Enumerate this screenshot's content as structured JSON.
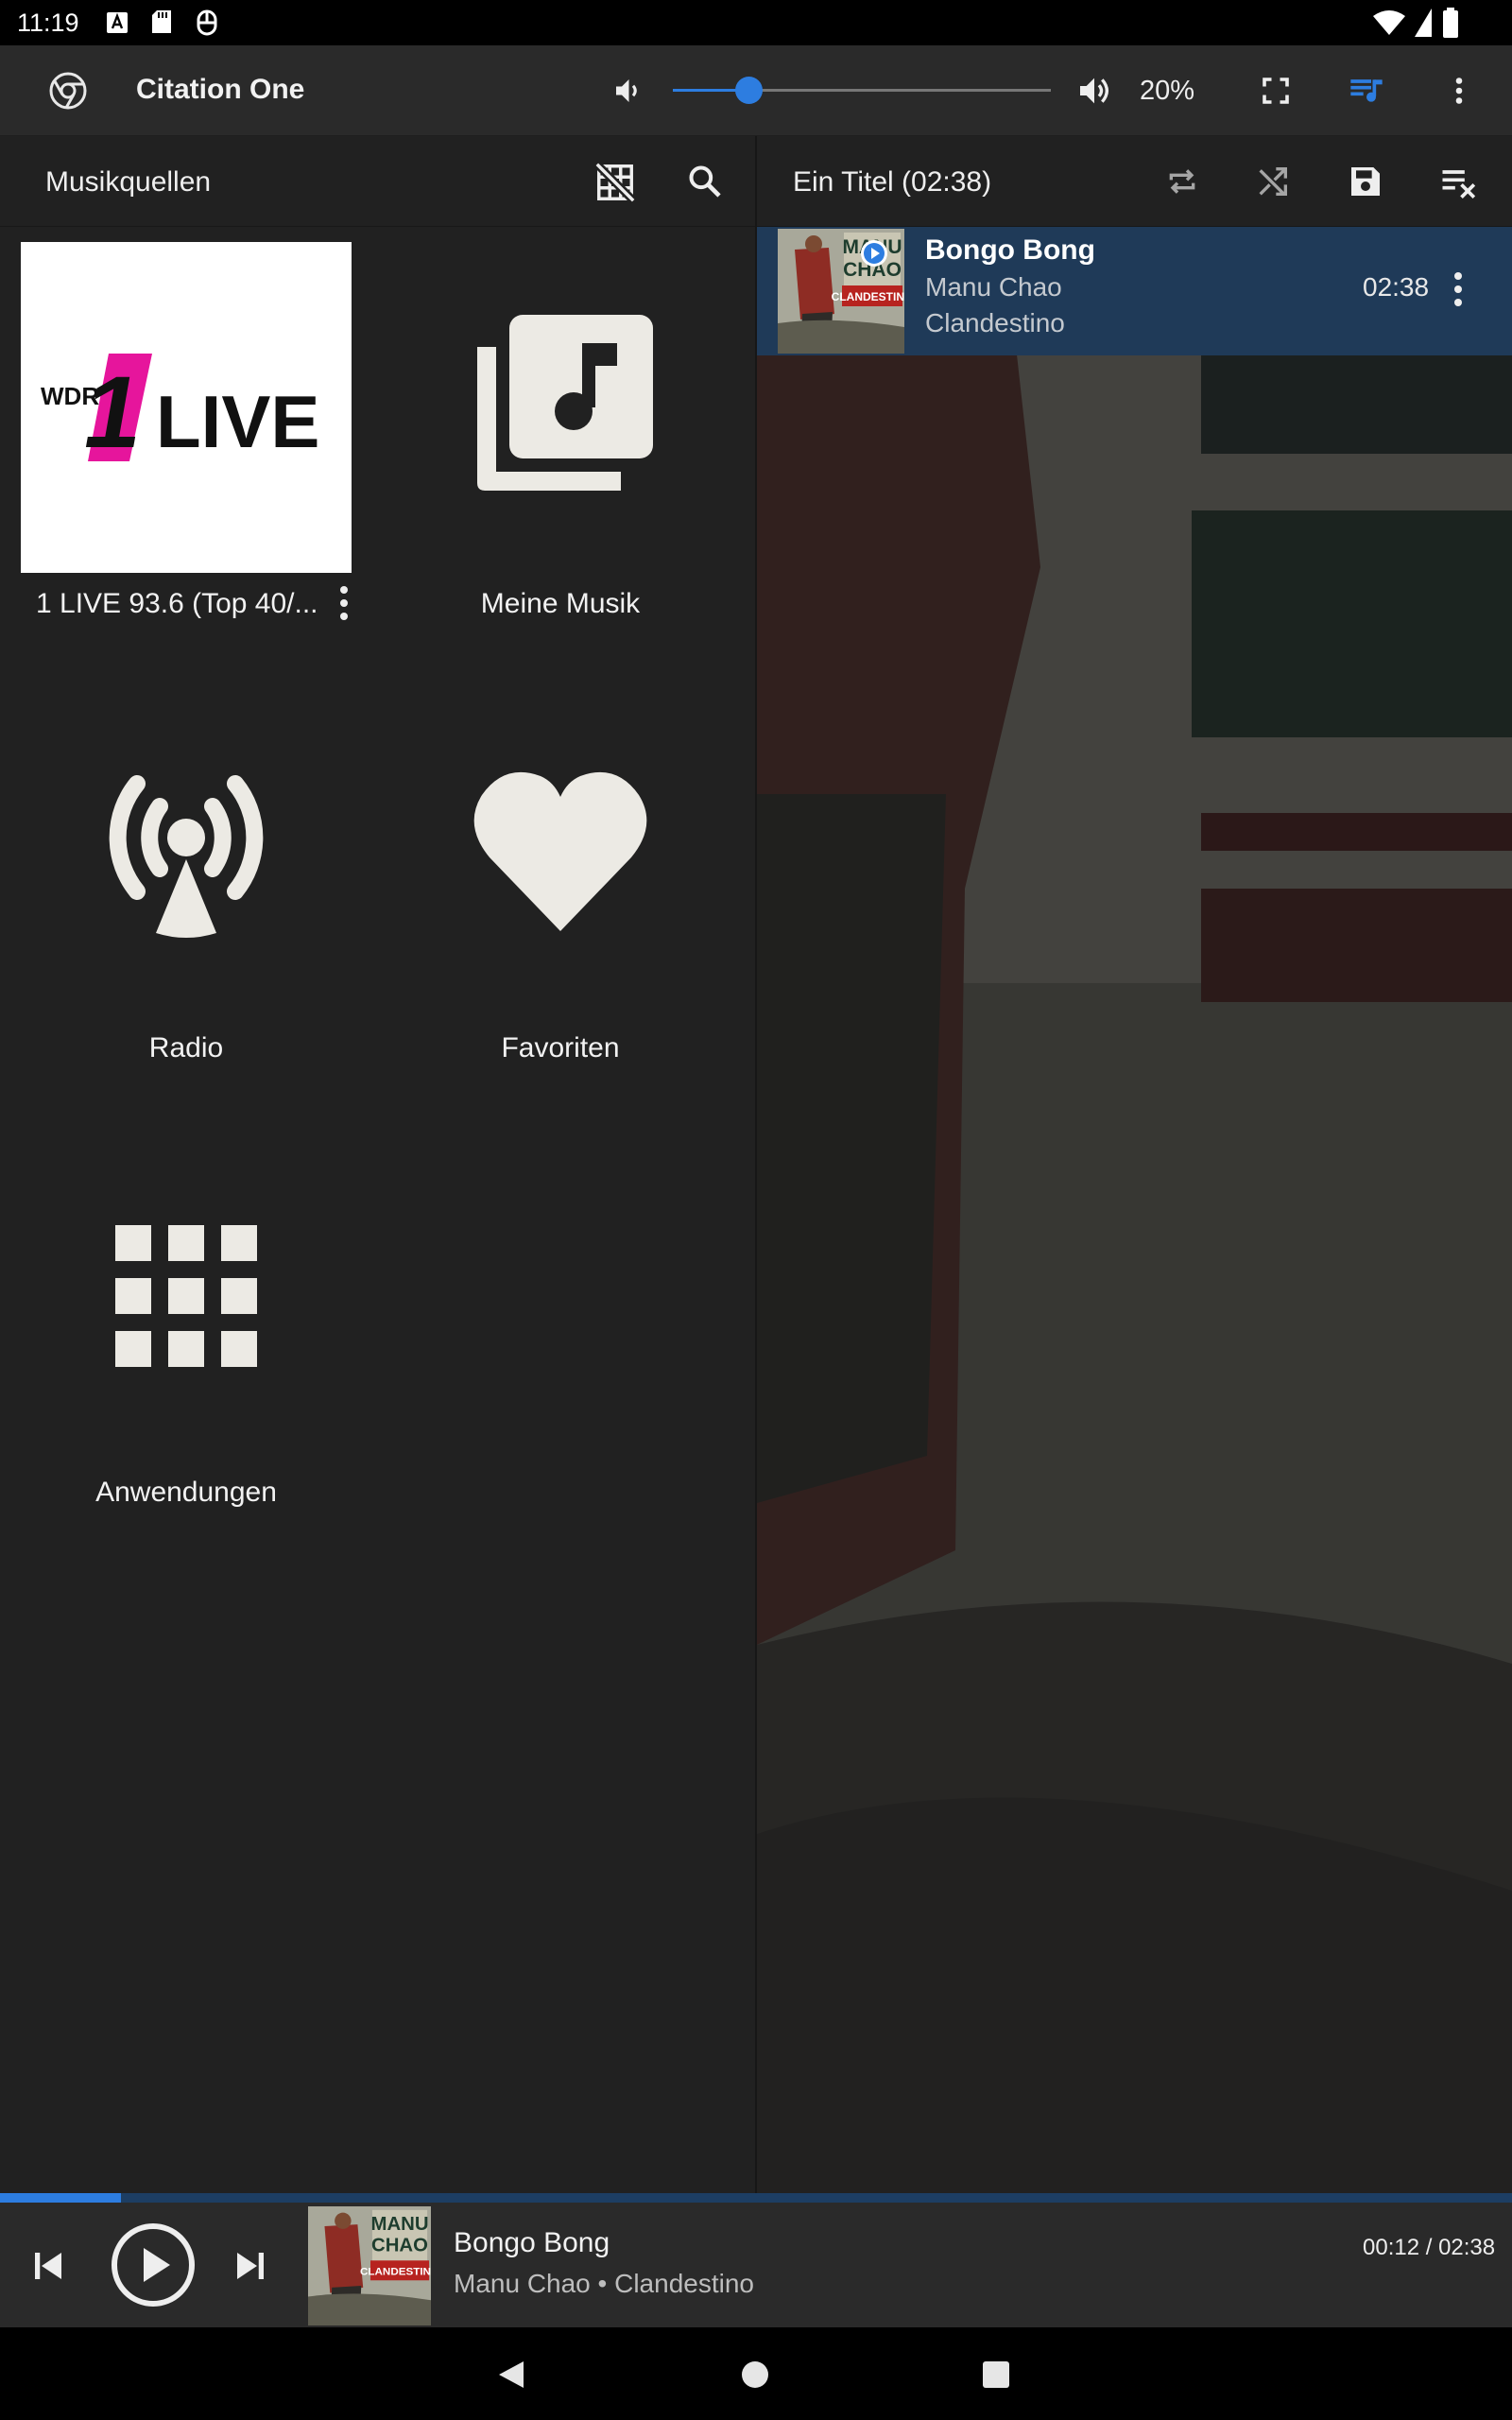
{
  "status_bar": {
    "time": "11:19"
  },
  "app_bar": {
    "title": "Citation One",
    "volume_level": 0.2,
    "volume_text": "20%"
  },
  "sources": {
    "title": "Musikquellen",
    "tiles": [
      {
        "label": "1 LIVE 93.6 (Top 40/...",
        "icon": "1live-logo"
      },
      {
        "label": "Meine Musik",
        "icon": "music-library-icon"
      },
      {
        "label": "Radio",
        "icon": "radio-tower-icon"
      },
      {
        "label": "Favoriten",
        "icon": "heart-icon"
      },
      {
        "label": "Anwendungen",
        "icon": "apps-grid-icon"
      }
    ],
    "logo_text": {
      "wdr": "WDR",
      "one": "1",
      "live": "LIVE"
    }
  },
  "queue": {
    "title": "Ein Titel (02:38)",
    "tracks": [
      {
        "title": "Bongo Bong",
        "artist": "Manu Chao",
        "album": "Clandestino",
        "duration": "02:38"
      }
    ],
    "album_art_text": {
      "line1": "MANU",
      "line2": "CHAO",
      "line3": "CLANDESTINO"
    }
  },
  "player": {
    "title": "Bongo Bong",
    "subtitle": "Manu Chao • Clandestino",
    "time": "00:12 / 02:38",
    "progress": 0.08
  },
  "colors": {
    "accent": "#2d7de0",
    "selected_row": "#1f3a58",
    "panel": "#212121",
    "icon_fill": "#eceae4"
  }
}
